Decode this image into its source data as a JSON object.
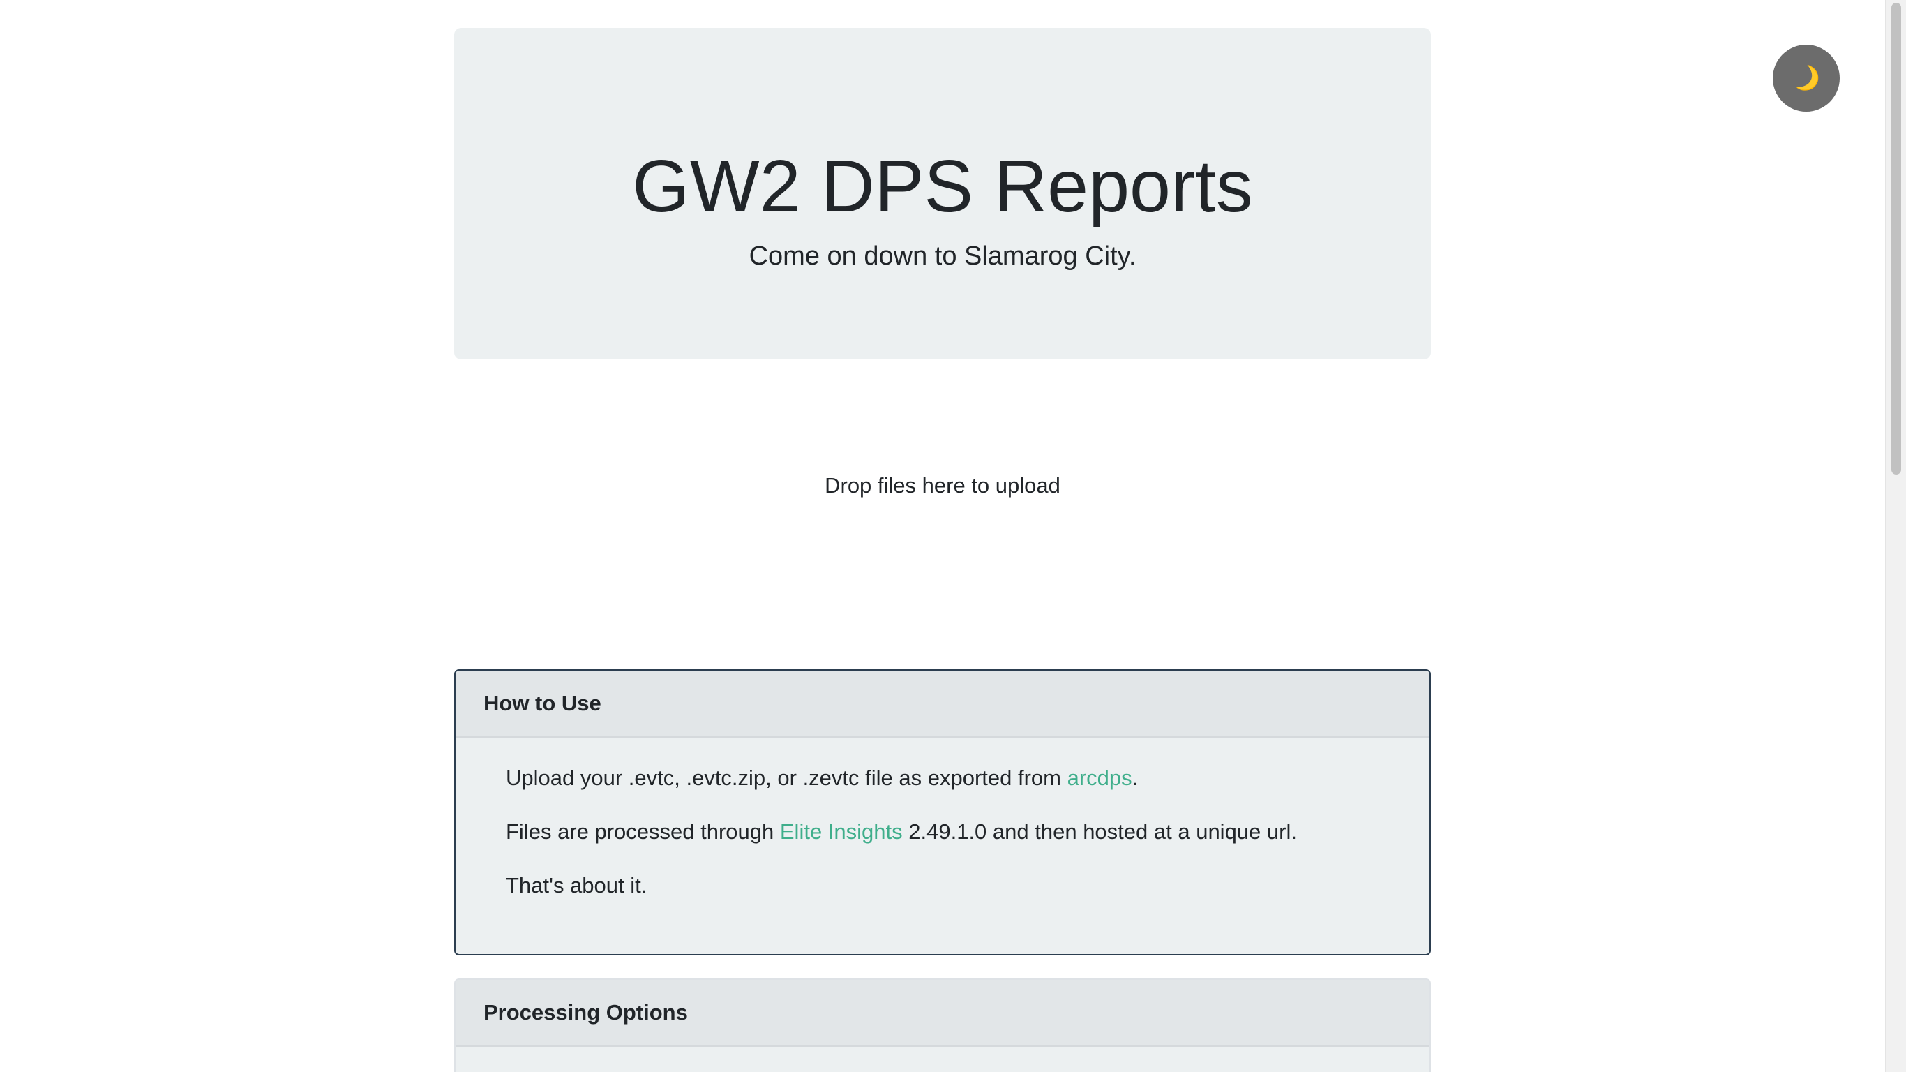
{
  "header": {
    "title": "GW2 DPS Reports",
    "tagline": "Come on down to Slamarog City."
  },
  "theme_toggle": {
    "icon": "moon-icon",
    "glyph": "🌙"
  },
  "dropzone": {
    "label": "Drop files here to upload"
  },
  "how_to_use": {
    "title": "How to Use",
    "line1": {
      "before": "Upload your .evtc, .evtc.zip, or .zevtc file as exported from ",
      "link": "arcdps",
      "after": "."
    },
    "line2": {
      "before": "Files are processed through ",
      "link": "Elite Insights",
      "after": " 2.49.1.0 and then hosted at a unique url."
    },
    "line3": "That's about it."
  },
  "processing_options": {
    "title": "Processing Options"
  },
  "colors": {
    "jumbotron_bg": "#ecf0f1",
    "link": "#3fae8b",
    "card_border_active": "#2c3e50",
    "toggle_bg": "#6c6c6c"
  }
}
